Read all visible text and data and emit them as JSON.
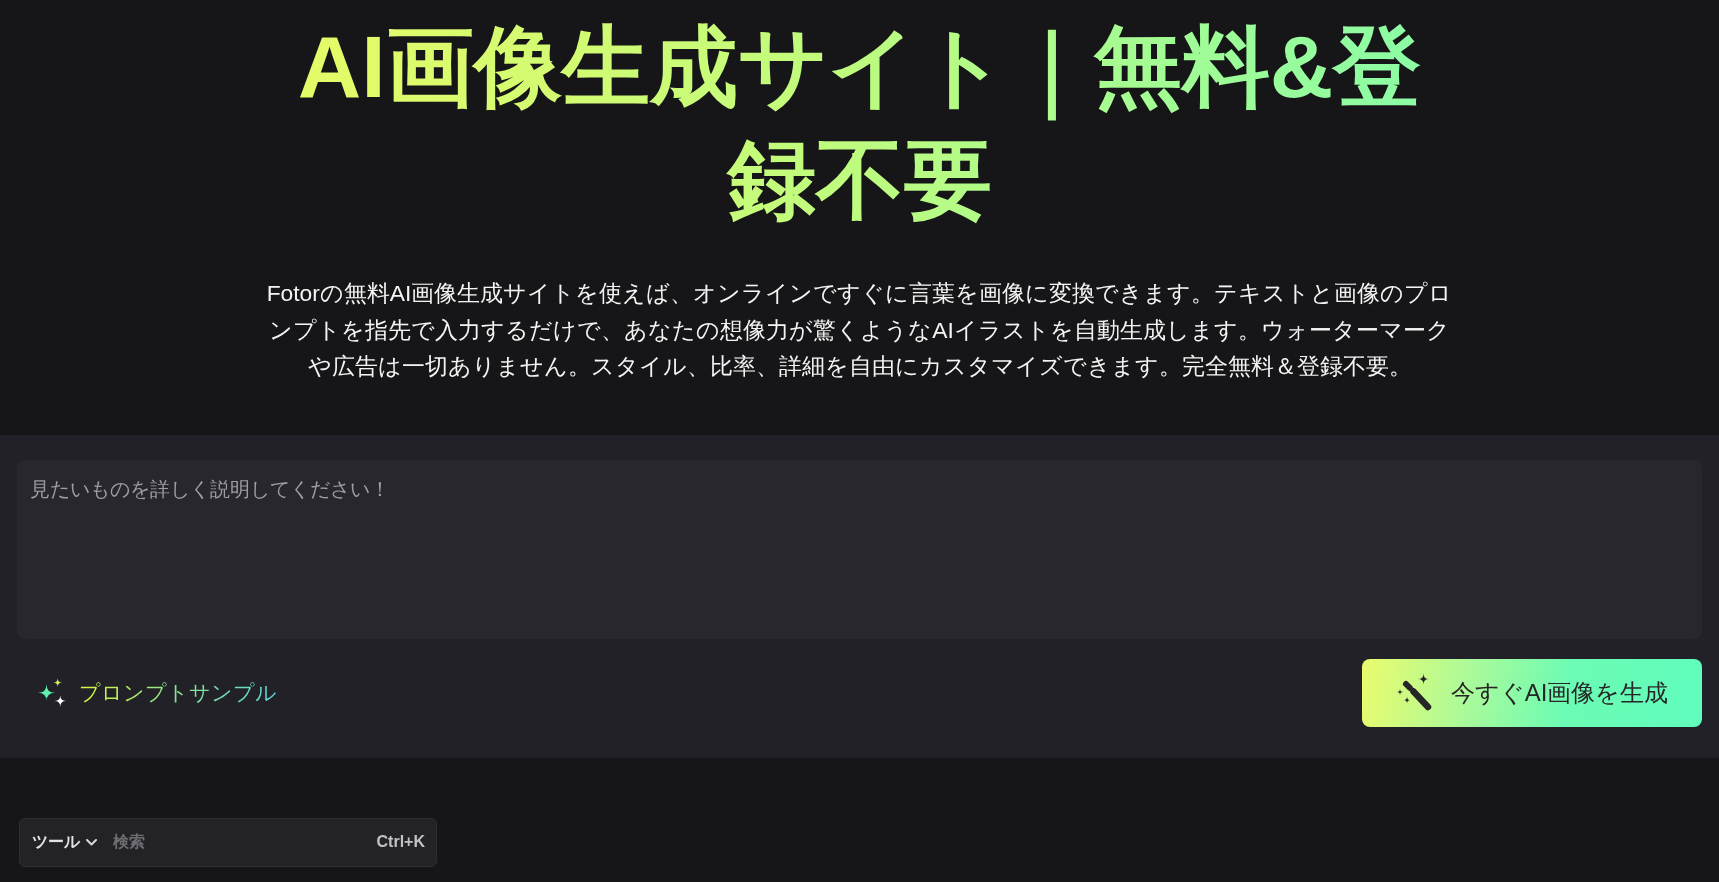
{
  "hero": {
    "title": "AI画像生成サイト｜無料&登録不要",
    "description": "Fotorの無料AI画像生成サイトを使えば、オンラインですぐに言葉を画像に変換できます。テキストと画像のプロンプトを指先で入力するだけで、あなたの想像力が驚くようなAIイラストを自動生成します。ウォーターマークや広告は一切ありません。スタイル、比率、詳細を自由にカスタマイズできます。完全無料＆登録不要。"
  },
  "prompt_panel": {
    "placeholder": "見たいものを詳しく説明してください！",
    "sample_link": "プロンプトサンプル",
    "generate_button": "今すぐAI画像を生成"
  },
  "tool_search": {
    "category": "ツール",
    "placeholder": "検索",
    "shortcut": "Ctrl+K"
  }
}
